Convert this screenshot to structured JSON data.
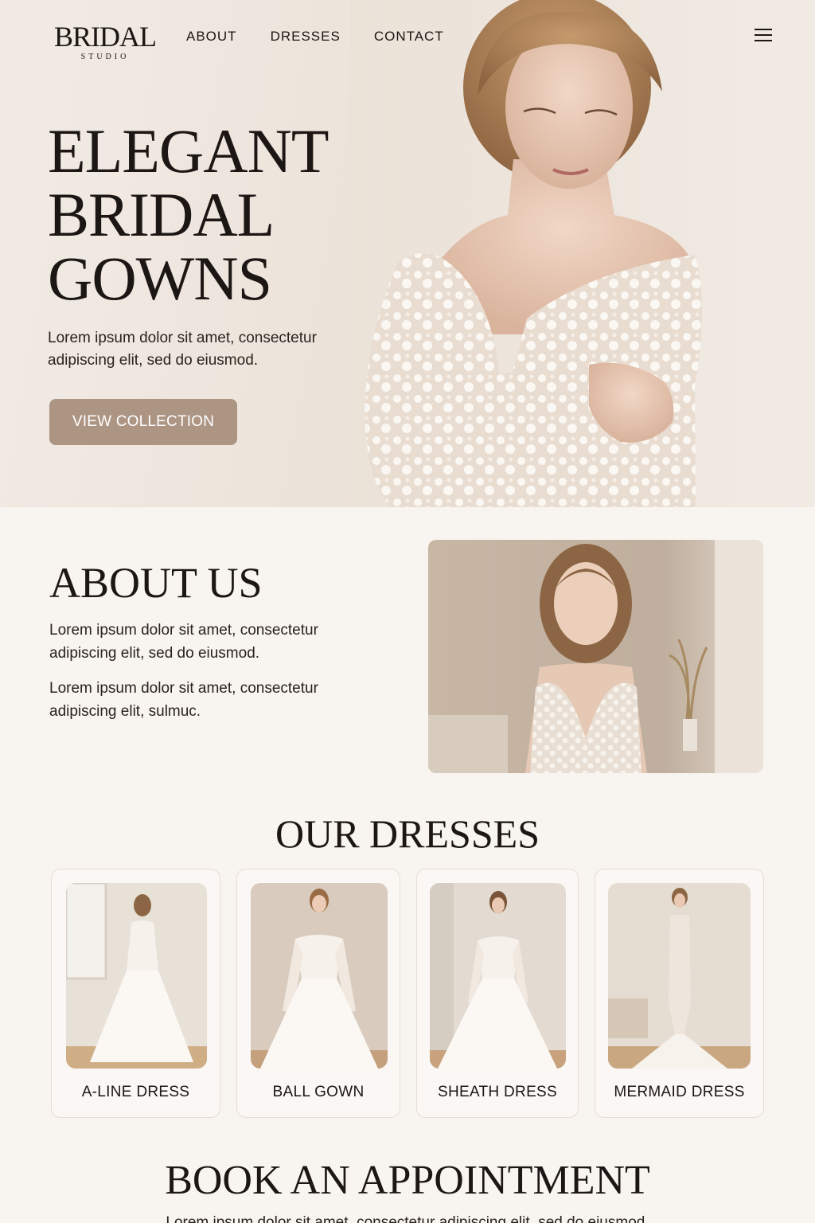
{
  "brand": {
    "name": "BRIDAL",
    "sub": "STUDIO"
  },
  "nav": {
    "items": [
      "ABOUT",
      "DRESSES",
      "CONTACT"
    ]
  },
  "hero": {
    "title_lines": [
      "ELEGANT",
      "BRIDAL",
      "GOWNS"
    ],
    "text": "Lorem ipsum dolor sit amet, consectetur adipiscing elit, sed do eiusmod.",
    "cta": "VIEW COLLECTION"
  },
  "about": {
    "title": "ABOUT US",
    "p1": "Lorem ipsum dolor sit amet, consectetur adipiscing elit, sed do eiusmod.",
    "p2": "Lorem ipsum dolor sit amet, consectetur adipiscing elit, sulmuc."
  },
  "dresses": {
    "title": "OUR DRESSES",
    "items": [
      {
        "label": "A-LINE DRESS"
      },
      {
        "label": "BALL GOWN"
      },
      {
        "label": "SHEATH DRESS"
      },
      {
        "label": "MERMAID DRESS"
      }
    ]
  },
  "book": {
    "title": "BOOK AN APPOINTMENT",
    "text": "Lorem ipsum dolor sit amet, consectetur adipiscing elit, sed do eiusmod."
  },
  "colors": {
    "accent": "#ad9584",
    "background": "#f8f4f0",
    "text": "#1c1714"
  },
  "icons": {
    "menu": "hamburger-menu-icon"
  }
}
